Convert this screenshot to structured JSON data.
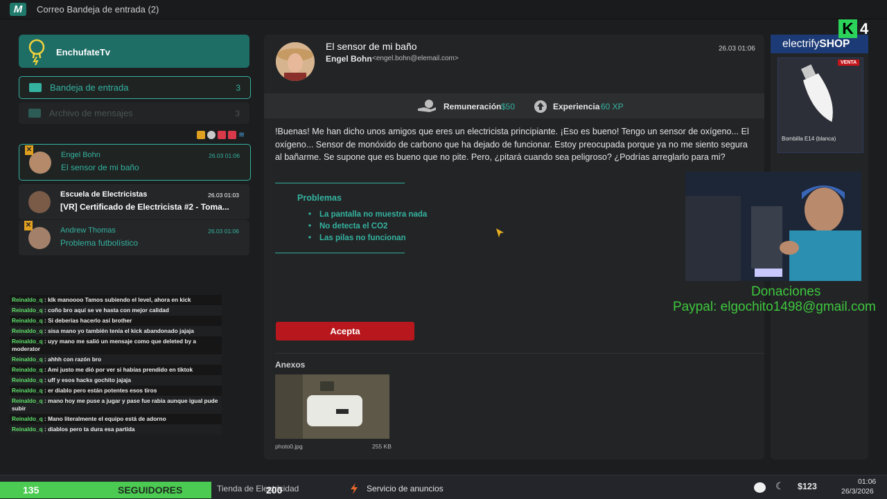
{
  "titlebar": {
    "title": "Correo  Bandeja de entrada  (2)"
  },
  "sidebar": {
    "brand": "EnchufateTv",
    "folders": [
      {
        "label": "Bandeja de entrada",
        "count": "3"
      },
      {
        "label": "Archivo de mensajes",
        "count": "3"
      }
    ],
    "mails": [
      {
        "from": "Engel Bohn",
        "subject": "El sensor de mi baño",
        "date": "26.03 01:06"
      },
      {
        "from": "Escuela de Electricistas",
        "subject": "[VR] Certificado de Electricista #2 - Toma...",
        "date": "26.03 01:03"
      },
      {
        "from": "Andrew Thomas",
        "subject": "Problema futbolístico",
        "date": "26.03 01:06"
      }
    ]
  },
  "chat": [
    {
      "user": "Reinaldo_q",
      "text": " : klk manoooo Tamos subiendo el level, ahora en kick"
    },
    {
      "user": "Reinaldo_q",
      "text": " : coño bro aquí se ve hasta con mejor calidad"
    },
    {
      "user": "Reinaldo_q",
      "text": " : Si deberías hacerlo así brother"
    },
    {
      "user": "Reinaldo_q",
      "text": " : sisa mano yo también tenía el kick abandonado jajaja"
    },
    {
      "user": "Reinaldo_q",
      "text": " : uyy mano me salió un mensaje como que deleted by a moderator"
    },
    {
      "user": "Reinaldo_q",
      "text": " : ahhh con razón bro"
    },
    {
      "user": "Reinaldo_q",
      "text": " : Ami justo me dió por ver si habías prendido en tiktok"
    },
    {
      "user": "Reinaldo_q",
      "text": " : uff y esos hacks gochito jajaja"
    },
    {
      "user": "Reinaldo_q",
      "text": " : er diablo pero están potentes esos tiros"
    },
    {
      "user": "Reinaldo_q",
      "text": " : mano hoy me puse a jugar y pase fue rabia aunque igual pude subir"
    },
    {
      "user": "Reinaldo_q",
      "text": " : Mano literalmente el equipo está de adorno"
    },
    {
      "user": "Reinaldo_q",
      "text": " : diablos pero ta dura esa partida"
    }
  ],
  "message": {
    "subject": "El sensor de mi baño",
    "from": "Engel Bohn",
    "email": "<engel.bohn@elemail.com>",
    "date": "26.03 01:06",
    "reward_label": "Remuneración",
    "reward_value": "$50",
    "exp_label": "Experiencia",
    "exp_value": "60 XP",
    "body": "!Buenas! Me han dicho unos amigos que eres un electricista principiante. ¡Eso es bueno! Tengo un sensor de oxígeno... El oxígeno... Sensor de monóxido de carbono que ha dejado de funcionar. Estoy preocupada porque ya no me siento segura al bañarme. Se supone que es bueno que no pite. Pero, ¿pitará cuando sea peligroso? ¿Podrías arreglarlo para mi?",
    "problems_title": "Problemas",
    "problems": [
      "La pantalla no muestra nada",
      "No detecta el CO2",
      "Las pilas no funcionan"
    ],
    "accept": "Acepta",
    "annex_title": "Anexos",
    "annex_name": "photo0.jpg",
    "annex_size": "255 KB"
  },
  "shop": {
    "title_a": "electrify",
    "title_b": "SHOP",
    "badge": "VENTA",
    "product": "Bombilla E14 (blanca)"
  },
  "overlay": {
    "kick_num": "4",
    "don_title": "Donaciones",
    "don_paypal": "Paypal: elgochito1498@gmail.com",
    "followers_count": "135",
    "followers_label": "SEGUIDORES",
    "followers_goal": "200"
  },
  "taskbar": {
    "store": "Tienda de Electricidad",
    "ads": "Servicio de anuncios",
    "money": "$123",
    "time": "01:06",
    "date": "26/3/2026"
  },
  "colors": {
    "accent": "#34b3a0",
    "accept": "#b8181d",
    "followers": "#4bcb52"
  },
  "icons": [
    "app-logo-icon",
    "bulb-icon",
    "envelope-icon",
    "archive-icon",
    "money-hand-icon",
    "arrow-up-icon",
    "lightning-icon",
    "moon-icon",
    "toggle-icon",
    "cursor-icon"
  ]
}
